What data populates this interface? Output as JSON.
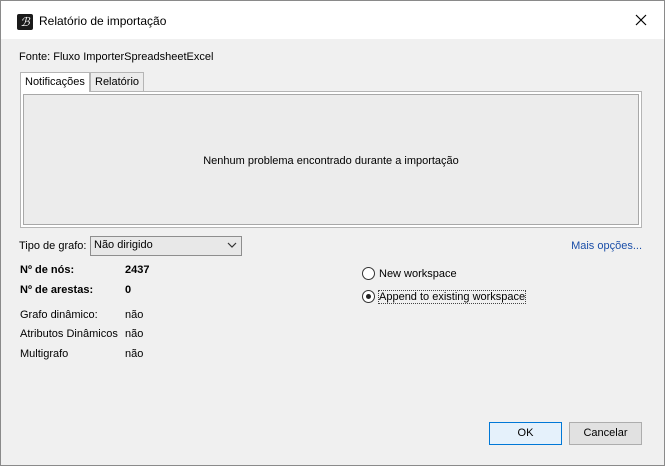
{
  "window": {
    "title": "Relatório de importação",
    "icon": "graph-app-icon"
  },
  "source": {
    "text": "Fonte:  Fluxo ImporterSpreadsheetExcel"
  },
  "tabs": [
    {
      "label": "Notificações",
      "active": true
    },
    {
      "label": "Relatório",
      "active": false
    }
  ],
  "notifications": {
    "message": "Nenhum problema encontrado durante a importação"
  },
  "graph_type": {
    "label": "Tipo de grafo:",
    "selected": "Não dirigido"
  },
  "more_options": "Mais opções...",
  "stats": {
    "nodes_label": "Nº de nós:",
    "nodes_value": "2437",
    "edges_label": "Nº de arestas:",
    "edges_value": "0",
    "dynamic_label": "Grafo dinâmico:",
    "dynamic_value": "não",
    "dyn_attr_label": "Atributos Dinâmicos",
    "dyn_attr_value": "não",
    "multigraph_label": "Multigrafo",
    "multigraph_value": "não"
  },
  "workspace": {
    "new_label": "New workspace",
    "append_label": "Append to existing workspace",
    "selected": "append"
  },
  "buttons": {
    "ok": "OK",
    "cancel": "Cancelar"
  },
  "colors": {
    "link": "#1a4ea8",
    "default_button_border": "#0078d7"
  }
}
